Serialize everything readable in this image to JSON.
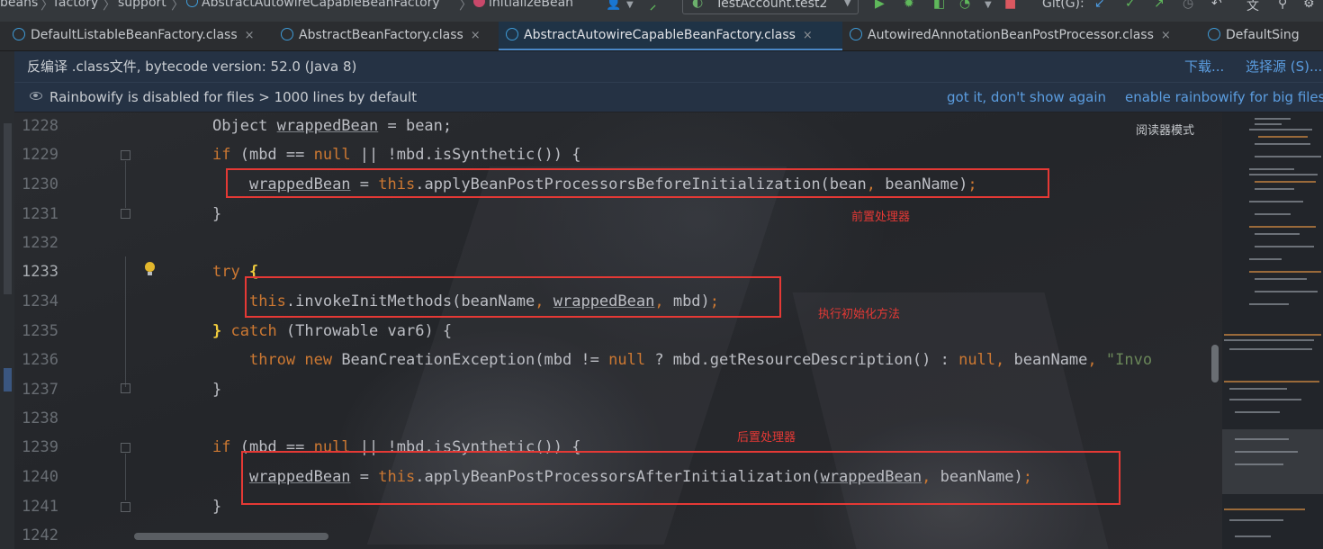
{
  "navbar": {
    "breadcrumbs": [
      "beans",
      "factory",
      "support",
      "AbstractAutowireCapableBeanFactory",
      "initializeBean"
    ],
    "run_config": "TestAccount.test2",
    "git_label": "Git(G):"
  },
  "tabs": [
    {
      "label": "DefaultListableBeanFactory.class",
      "close": "×"
    },
    {
      "label": "AbstractBeanFactory.class",
      "close": "×"
    },
    {
      "label": "AbstractAutowireCapableBeanFactory.class",
      "close": "×"
    },
    {
      "label": "AutowiredAnnotationBeanPostProcessor.class",
      "close": "×"
    },
    {
      "label": "DefaultSing",
      "close": ""
    }
  ],
  "decompile_banner": {
    "text": "反编译 .class文件, bytecode version: 52.0 (Java 8)",
    "download": "下载...",
    "choose_source": "选择源 (S)..."
  },
  "rainbow_banner": {
    "text": "Rainbowify is disabled for files > 1000 lines by default",
    "dismiss": "got it, don't show again",
    "enable": "enable rainbowify for big files"
  },
  "editor": {
    "reader_mode": "阅读器模式",
    "line_numbers": [
      "1228",
      "1229",
      "1230",
      "1231",
      "1232",
      "1233",
      "1234",
      "1235",
      "1236",
      "1237",
      "1238",
      "1239",
      "1240",
      "1241",
      "1242"
    ],
    "annotations": {
      "before": "前置处理器",
      "invoke": "执行初始化方法",
      "after": "后置处理器"
    }
  },
  "colors": {
    "keyword": "#cc7832",
    "highlight_box": "#e53935",
    "link": "#5b9de0",
    "banner_bg": "#253244"
  }
}
